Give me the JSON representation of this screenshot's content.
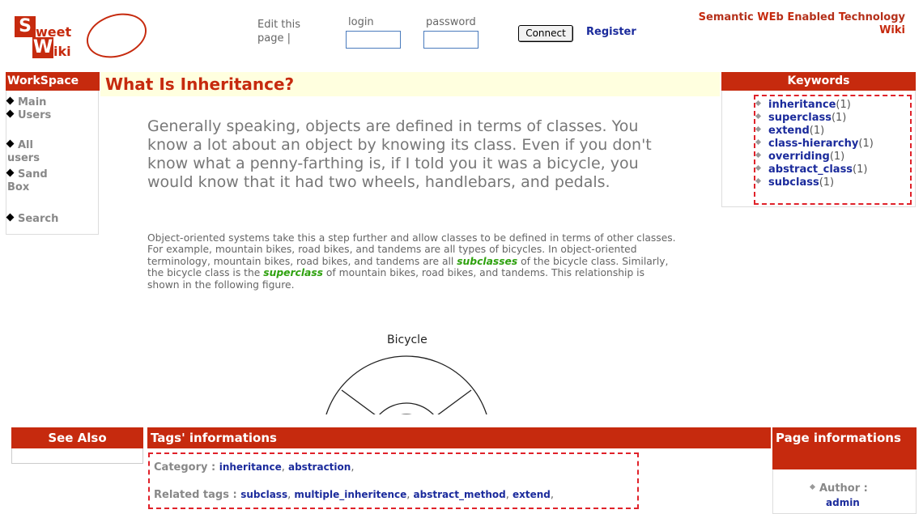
{
  "logo": {
    "letter1": "S",
    "rest1": "weet",
    "letter2": "W",
    "rest2": "iki"
  },
  "header": {
    "edit_link": "Edit this page |",
    "login_label": "login",
    "password_label": "password",
    "connect_label": "Connect",
    "register_label": "Register",
    "site_name_line1_parts": [
      "S",
      "emantic ",
      "WE",
      "b ",
      "E",
      "nabled ",
      "T",
      "echnology"
    ],
    "site_name_line2": "Wiki"
  },
  "workspace": {
    "title": "WorkSpace",
    "items": [
      {
        "label": "Main"
      },
      {
        "label": "Users"
      },
      {
        "label": "All users"
      },
      {
        "label": "Sand Box"
      },
      {
        "label": "Search"
      }
    ]
  },
  "page": {
    "title": "What Is Inheritance?",
    "lead": "Generally speaking, objects are defined in terms of classes. You know a lot about an object by knowing its class. Even if you don't know what a penny-farthing is, if I told you it was a bicycle, you would know that it had two wheels, handlebars, and pedals.",
    "body_part1": "Object-oriented systems take this a step further and allow classes to be defined in terms of other classes. For example, mountain bikes, road bikes, and tandems are all types of bicycles. In object-oriented terminology, mountain bikes, road bikes, and tandems are all ",
    "term1": "subclasses",
    "body_part2": " of the bicycle class. Similarly, the bicycle class is the ",
    "term2": "superclass",
    "body_part3": " of mountain bikes, road bikes, and tandems. This relationship is shown in the following figure.",
    "figure_caption": "Bicycle"
  },
  "keywords": {
    "title": "Keywords",
    "items": [
      {
        "name": "inheritance",
        "count": "(1)"
      },
      {
        "name": "superclass",
        "count": "(1)"
      },
      {
        "name": "extend",
        "count": "(1)"
      },
      {
        "name": "class-hierarchy",
        "count": "(1)"
      },
      {
        "name": "overriding",
        "count": "(1)"
      },
      {
        "name": "abstract_class",
        "count": "(1)"
      },
      {
        "name": "subclass",
        "count": "(1)"
      }
    ]
  },
  "bottom": {
    "see_also_title": "See Also",
    "tags_title": "Tags' informations",
    "category_label": "Category : ",
    "category_tags": [
      "inheritance",
      "abstraction"
    ],
    "related_label": "Related tags : ",
    "related_tags": [
      "subclass",
      "multiple_inheritence",
      "abstract_method",
      "extend"
    ],
    "page_info_title": "Page informations",
    "author_label": "Author :",
    "author_value": "admin"
  },
  "colors": {
    "accent": "#c62a0e",
    "link": "#1b2b9c",
    "highlight_term": "#2ea10e",
    "title_bg": "#ffffdf"
  }
}
